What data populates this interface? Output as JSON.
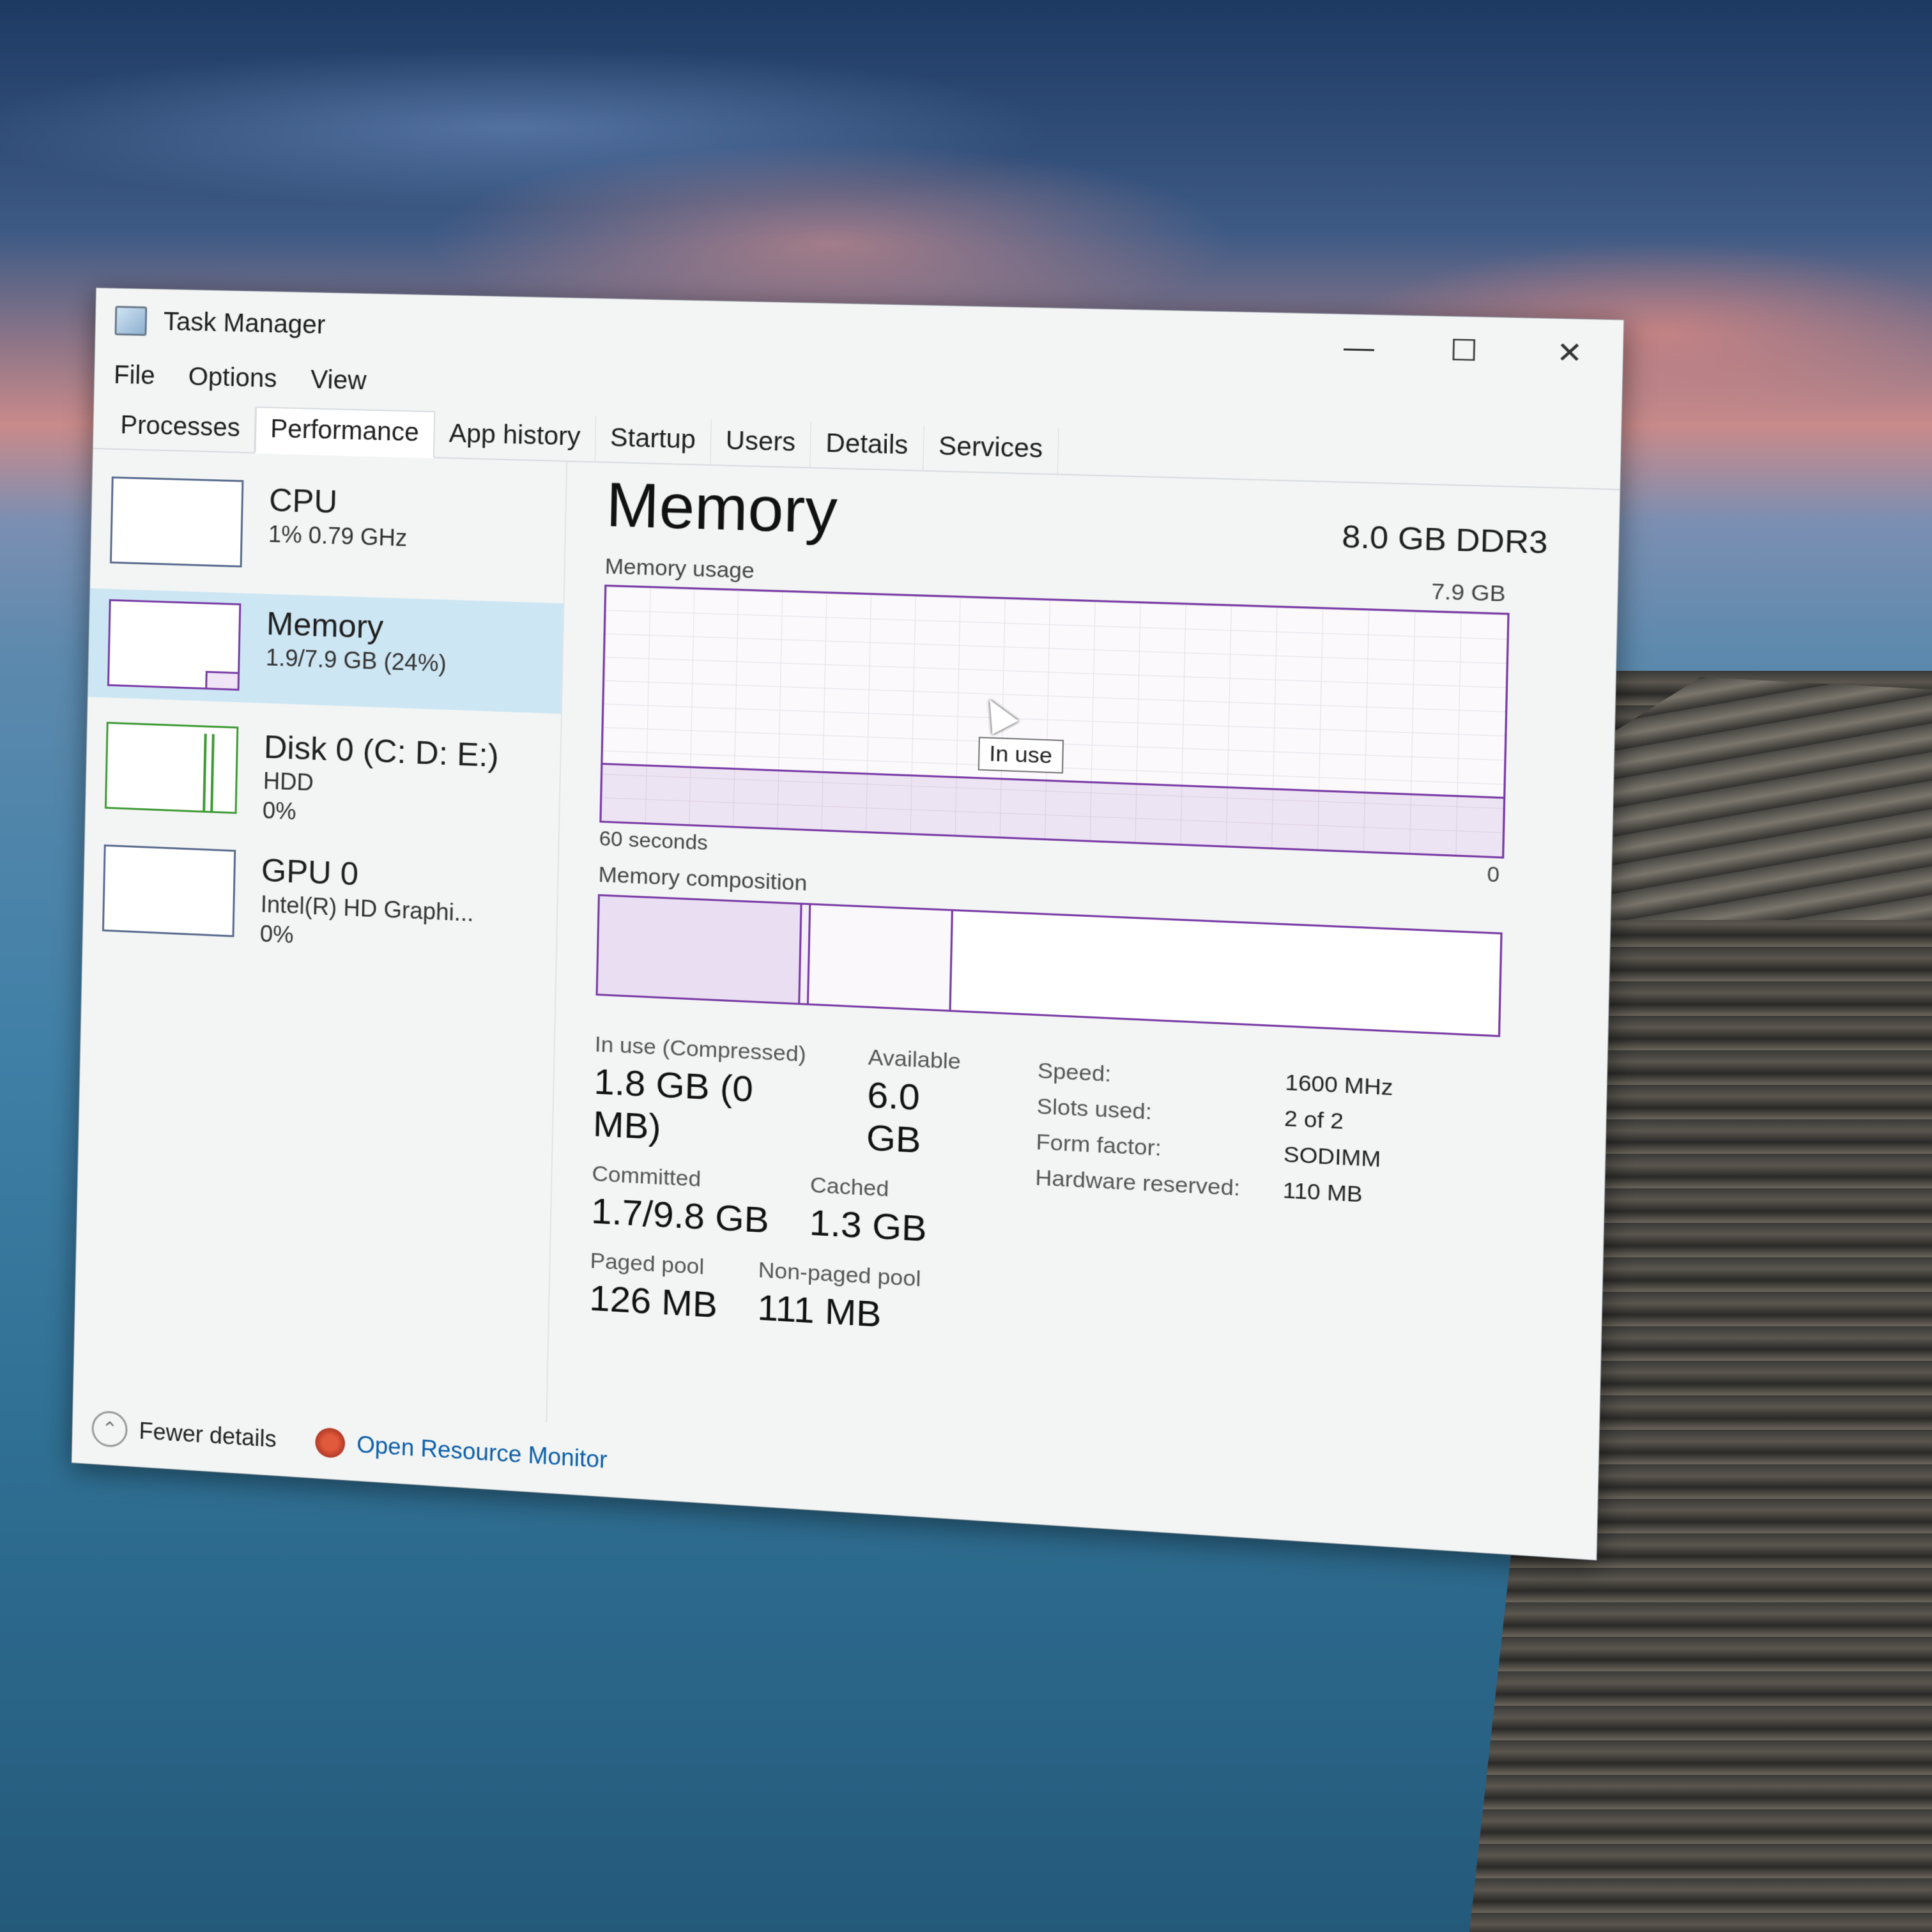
{
  "window": {
    "title": "Task Manager"
  },
  "menu": [
    "File",
    "Options",
    "View"
  ],
  "tabs": [
    {
      "label": "Processes"
    },
    {
      "label": "Performance",
      "active": true
    },
    {
      "label": "App history"
    },
    {
      "label": "Startup"
    },
    {
      "label": "Users"
    },
    {
      "label": "Details"
    },
    {
      "label": "Services"
    }
  ],
  "resources": [
    {
      "name": "CPU",
      "line1": "1% 0.79 GHz",
      "line2": ""
    },
    {
      "name": "Memory",
      "line1": "1.9/7.9 GB (24%)",
      "line2": "",
      "active": true
    },
    {
      "name": "Disk 0 (C: D: E:)",
      "line1": "HDD",
      "line2": "0%"
    },
    {
      "name": "GPU 0",
      "line1": "Intel(R) HD Graphi...",
      "line2": "0%"
    }
  ],
  "memory": {
    "title": "Memory",
    "spec": "8.0 GB DDR3",
    "usage_label": "Memory usage",
    "usage_max": "7.9 GB",
    "usage_fraction": 0.24,
    "axis_left": "60 seconds",
    "axis_right": "0",
    "tooltip": "In use",
    "composition_label": "Memory composition",
    "stats": {
      "in_use_label": "In use (Compressed)",
      "in_use": "1.8 GB (0 MB)",
      "available_label": "Available",
      "available": "6.0 GB",
      "committed_label": "Committed",
      "committed": "1.7/9.8 GB",
      "cached_label": "Cached",
      "cached": "1.3 GB",
      "paged_label": "Paged pool",
      "paged": "126 MB",
      "nonpaged_label": "Non-paged pool",
      "nonpaged": "111 MB"
    },
    "properties": [
      {
        "key": "Speed:",
        "value": "1600 MHz"
      },
      {
        "key": "Slots used:",
        "value": "2 of 2"
      },
      {
        "key": "Form factor:",
        "value": "SODIMM"
      },
      {
        "key": "Hardware reserved:",
        "value": "110 MB"
      }
    ]
  },
  "footer": {
    "fewer_details": "Fewer details",
    "open_resource_monitor": "Open Resource Monitor"
  }
}
